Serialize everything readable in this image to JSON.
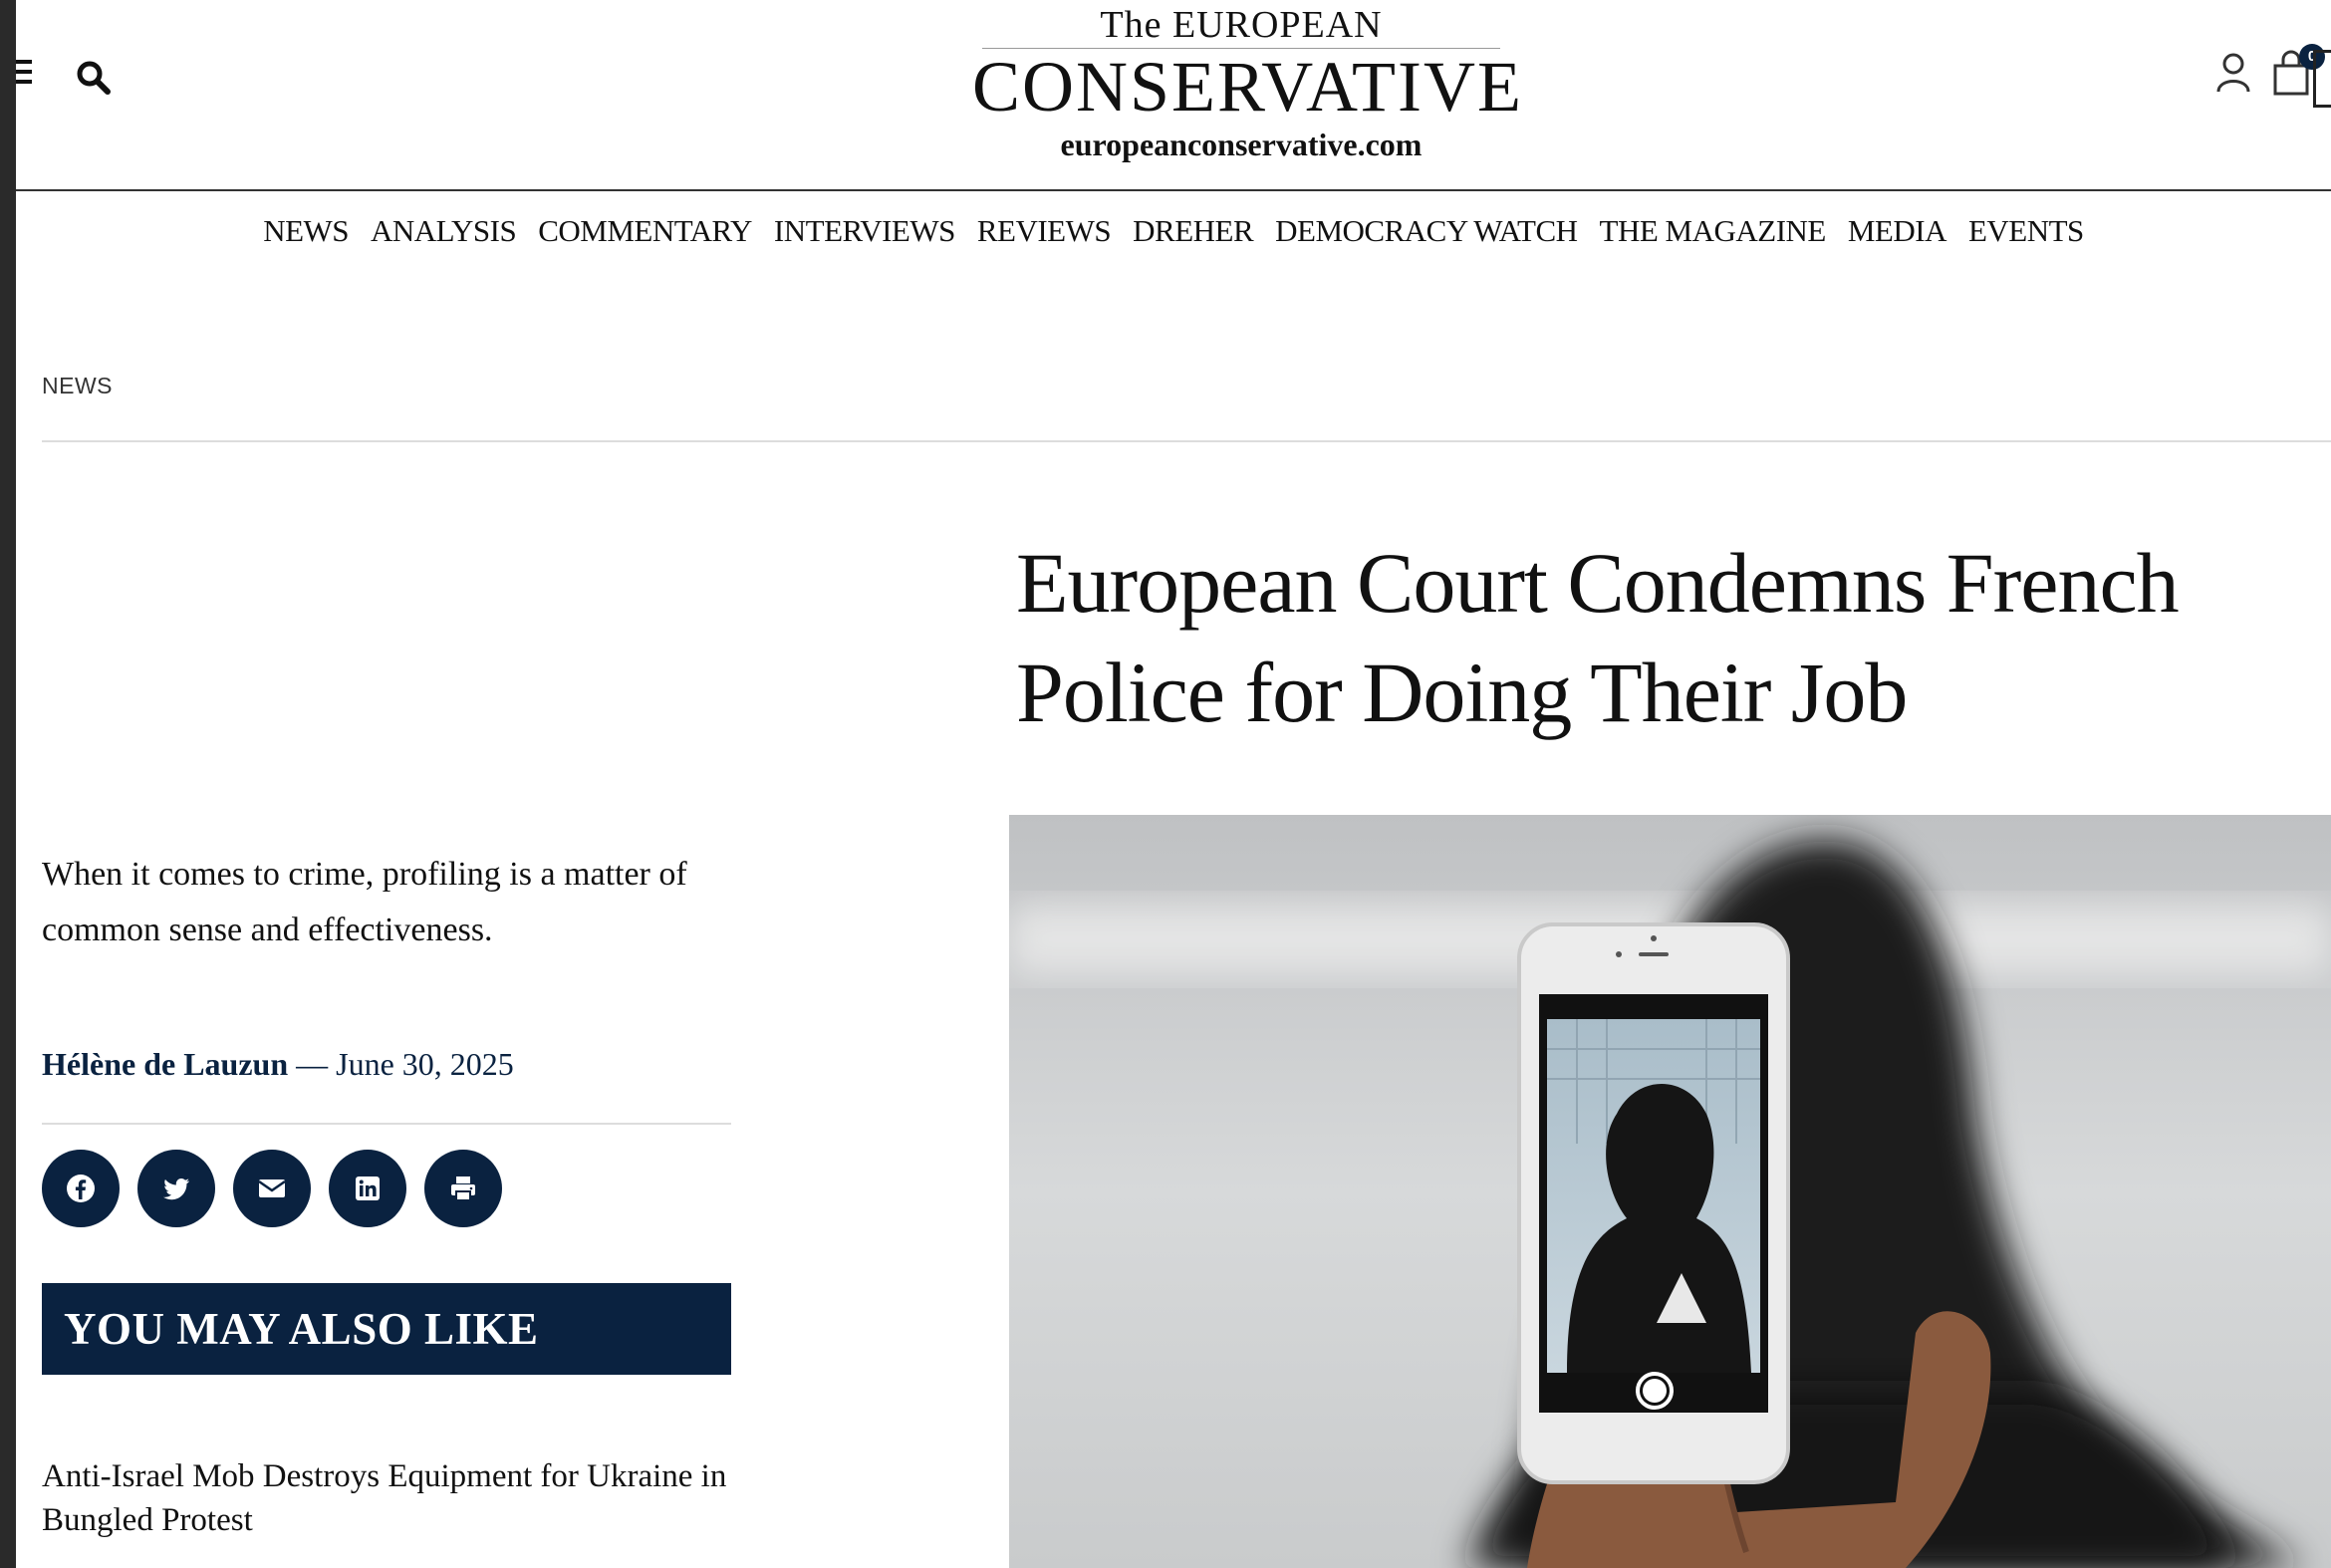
{
  "header": {
    "logo_top": "The EUROPEAN",
    "logo_main": "CONSERVATIVE",
    "logo_url": "europeanconservative.com",
    "cart_count": "0",
    "icons": [
      "menu-icon",
      "search-icon",
      "user-icon",
      "cart-icon"
    ]
  },
  "nav": {
    "items": [
      "NEWS",
      "ANALYSIS",
      "COMMENTARY",
      "INTERVIEWS",
      "REVIEWS",
      "DREHER",
      "DEMOCRACY WATCH",
      "THE MAGAZINE",
      "MEDIA",
      "EVENTS"
    ]
  },
  "breadcrumb": "NEWS",
  "article": {
    "title": "European Court Condemns French Police for Doing Their Job",
    "lead": "When it comes to crime, profiling is a matter of common sense and effectiveness.",
    "author": "Hélène de Lauzun",
    "separator": " — ",
    "date": "June 30, 2025"
  },
  "share": {
    "icons": [
      "facebook-icon",
      "twitter-icon",
      "email-icon",
      "linkedin-icon",
      "print-icon"
    ]
  },
  "also_like": {
    "heading": "YOU MAY ALSO LIKE",
    "items": [
      {
        "title": "Anti-Israel Mob Destroys Equipment for Ukraine in Bungled Protest"
      }
    ]
  },
  "colors": {
    "navy": "#0a2240",
    "text": "#111111",
    "rule": "#dddddd"
  }
}
